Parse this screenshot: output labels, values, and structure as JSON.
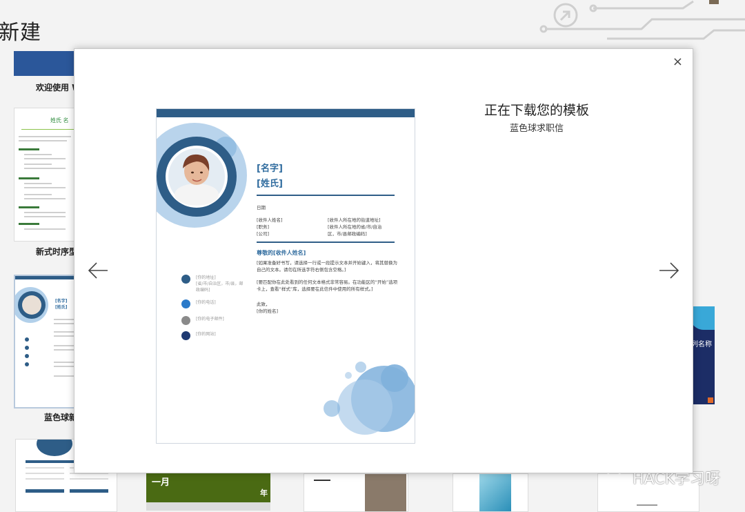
{
  "page": {
    "title": "新建",
    "template_labels": [
      "欢迎使用 W",
      "新式时序型",
      "蓝色球新"
    ],
    "partial_texts": [
      "列名称",
      "一月",
      "年"
    ],
    "watermark": "HACK学习呀"
  },
  "dialog": {
    "close_symbol": "×",
    "prev_label": "←",
    "next_label": "→",
    "status_title": "正在下载您的模板",
    "template_name": "蓝色球求职信"
  },
  "preview": {
    "name": "[名字]",
    "surname": "[姓氏]",
    "date_label": "日期",
    "recipient": {
      "name": "[收件人姓名]",
      "title": "[职务]",
      "company": "[公司]",
      "street": "[收件人所在地的街道地址]",
      "city": "[收件人所在地的省/市/自治",
      "city2": "区，市/县邮政编码]"
    },
    "salutation": "尊敬的[收件人姓名]",
    "para1": "[如果准备好书写，请选择一行或一段提示文本并开始键入，将其替换为自己的文本。请勿在所选字符右侧包含空格。]",
    "para2": "[要匹配你在此处看到的任何文本格式非常容易。在功能区的“开始”选项卡上，查看“样式”库，选择要在此信件中使用的所有样式。]",
    "closing": "此致，",
    "sign": "[你的姓名]",
    "contacts": [
      "[你的地址]\n[省/市/自治区，市/县，邮政编码]",
      "[你的电话]",
      "[你的电子邮件]",
      "[你的网站]"
    ]
  },
  "colors": {
    "accent": "#2e5d87",
    "heading_blue": "#2f6b9e",
    "light_blue": "#7fb0dc"
  }
}
